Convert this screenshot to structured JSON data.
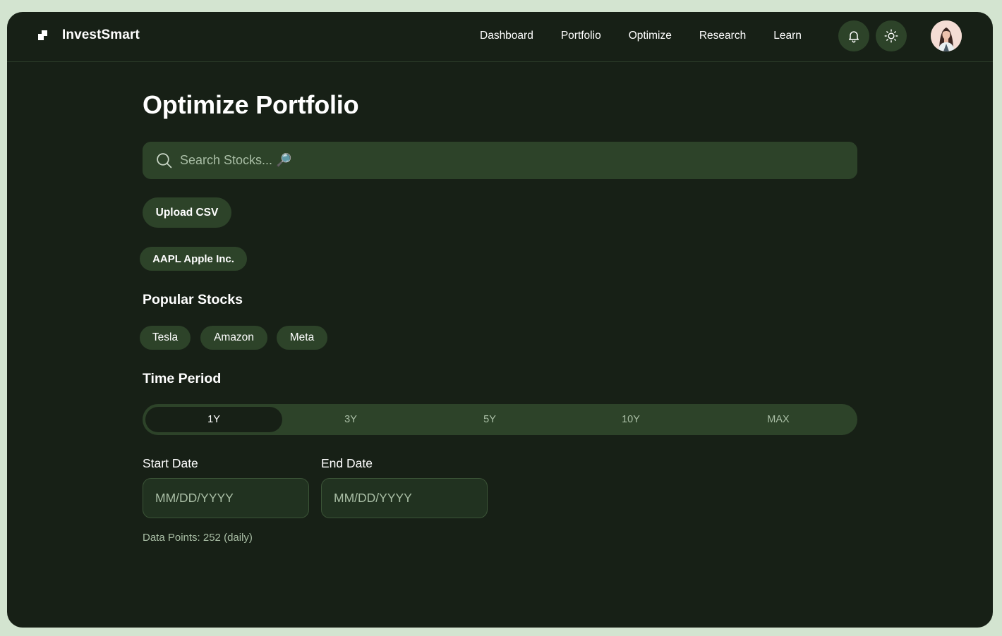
{
  "app": {
    "name": "InvestSmart"
  },
  "nav": {
    "items": [
      {
        "label": "Dashboard"
      },
      {
        "label": "Portfolio"
      },
      {
        "label": "Optimize"
      },
      {
        "label": "Research"
      },
      {
        "label": "Learn"
      }
    ]
  },
  "header_icons": [
    "bell-icon",
    "sun-icon"
  ],
  "page": {
    "title": "Optimize Portfolio"
  },
  "search": {
    "placeholder": "Search Stocks... 🔎",
    "value": ""
  },
  "upload": {
    "label": "Upload CSV"
  },
  "selected_stocks": [
    {
      "label": "AAPL Apple Inc."
    }
  ],
  "popular": {
    "title": "Popular Stocks",
    "items": [
      {
        "label": "Tesla"
      },
      {
        "label": "Amazon"
      },
      {
        "label": "Meta"
      }
    ]
  },
  "time_period": {
    "title": "Time Period",
    "options": [
      {
        "label": "1Y"
      },
      {
        "label": "3Y"
      },
      {
        "label": "5Y"
      },
      {
        "label": "10Y"
      },
      {
        "label": "MAX"
      }
    ],
    "selected": "1Y"
  },
  "dates": {
    "start": {
      "label": "Start Date",
      "placeholder": "MM/DD/YYYY",
      "value": ""
    },
    "end": {
      "label": "End Date",
      "placeholder": "MM/DD/YYYY",
      "value": ""
    }
  },
  "data_points": "Data Points: 252 (daily)",
  "colors": {
    "background": "#172016",
    "surface": "#2d4329",
    "muted_text": "#a9bea5",
    "outer": "#d3e4d0"
  }
}
